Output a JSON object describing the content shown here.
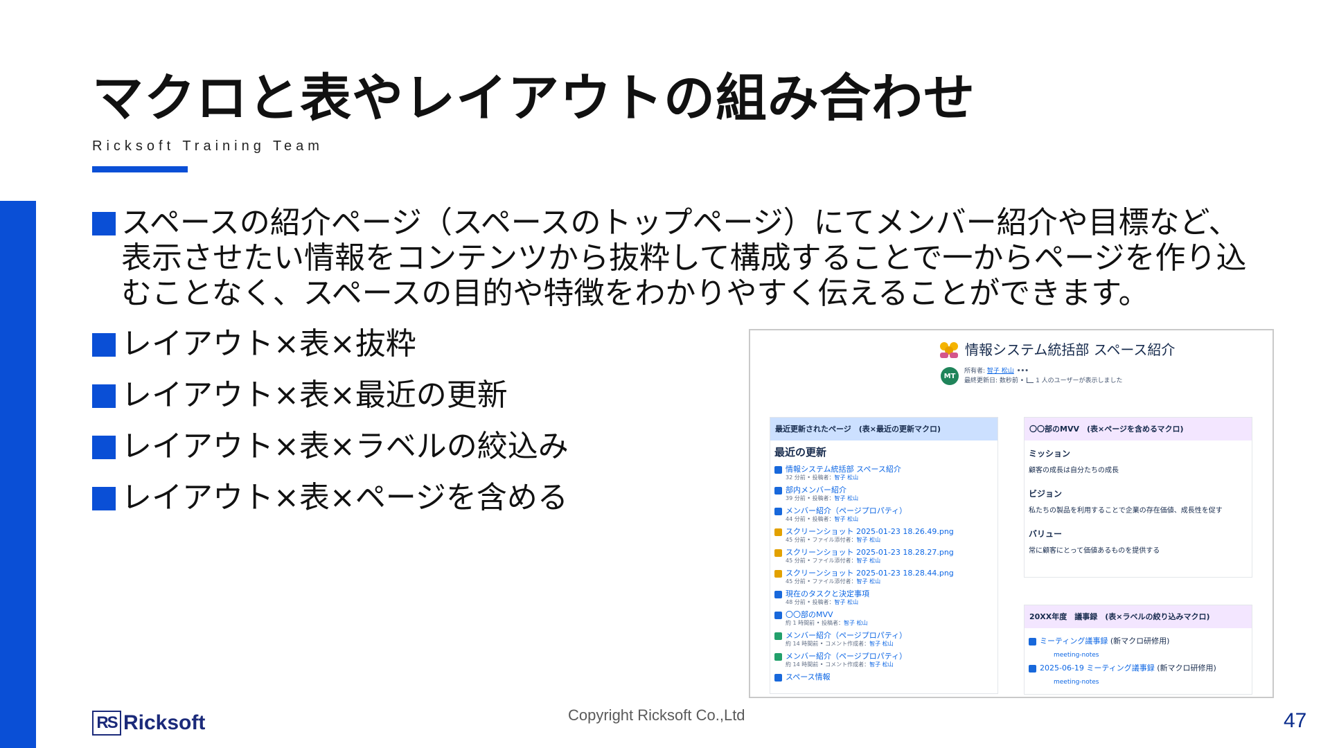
{
  "slide": {
    "title": "マクロと表やレイアウトの組み合わせ",
    "subtitle": "Ricksoft Training Team",
    "bullets": [
      "スペースの紹介ページ（スペースのトップページ）にてメンバー紹介や目標など、表示させたい情報をコンテンツから抜粋して構成することで一からページを作り込むことなく、スペースの目的や特徴をわかりやすく伝えることができます。",
      "レイアウト×表×抜粋",
      "レイアウト×表×最近の更新",
      "レイアウト×表×ラベルの絞込み",
      "レイアウト×表×ページを含める"
    ]
  },
  "screenshot": {
    "page_title": "情報システム統括部 スペース紹介",
    "owner_label": "所有者:",
    "owner_name": "智子 松山",
    "more_dots": "•••",
    "avatar_initials": "MT",
    "last_updated_label": "最終更新日: 数秒前 •",
    "viewers": "1 人のユーザーが表示しました",
    "left_column": {
      "header": "最近更新されたページ　(表×最近の更新マクロ)",
      "heading": "最近の更新",
      "items": [
        {
          "title": "情報システム統括部 スペース紹介",
          "meta": "32 分前 • 投稿者：",
          "who": "智子 松山",
          "icon": "page-icon"
        },
        {
          "title": "部内メンバー紹介",
          "meta": "39 分前 • 投稿者：",
          "who": "智子 松山",
          "icon": "page-icon"
        },
        {
          "title": "メンバー紹介（ページプロパティ）",
          "meta": "44 分前 • 投稿者：",
          "who": "智子 松山",
          "icon": "page-icon"
        },
        {
          "title": "スクリーンショット 2025-01-23 18.26.49.png",
          "meta": "45 分前 • ファイル添付者：",
          "who": "智子 松山",
          "icon": "image-icon"
        },
        {
          "title": "スクリーンショット 2025-01-23 18.28.27.png",
          "meta": "45 分前 • ファイル添付者：",
          "who": "智子 松山",
          "icon": "image-icon"
        },
        {
          "title": "スクリーンショット 2025-01-23 18.28.44.png",
          "meta": "45 分前 • ファイル添付者：",
          "who": "智子 松山",
          "icon": "image-icon"
        },
        {
          "title": "現在のタスクと決定事項",
          "meta": "48 分前 • 投稿者：",
          "who": "智子 松山",
          "icon": "page-icon"
        },
        {
          "title": "〇〇部のMVV",
          "meta": "約 1 時間前 • 投稿者：",
          "who": "智子 松山",
          "icon": "page-icon"
        },
        {
          "title": "メンバー紹介（ページプロパティ）",
          "meta": "約 14 時間前 • コメント作成者：",
          "who": "智子 松山",
          "icon": "comment-icon"
        },
        {
          "title": "メンバー紹介（ページプロパティ）",
          "meta": "約 14 時間前 • コメント作成者：",
          "who": "智子 松山",
          "icon": "comment-icon"
        },
        {
          "title": "スペース情報",
          "meta": "",
          "who": "",
          "icon": "page-icon"
        }
      ]
    },
    "right_top": {
      "header": "〇〇部のMVV　(表×ページを含めるマクロ)",
      "mission_h": "ミッション",
      "mission": "顧客の成長は自分たちの成長",
      "vision_h": "ビジョン",
      "vision": "私たちの製品を利用することで企業の存在価値、成長性を促す",
      "value_h": "バリュー",
      "value": "常に顧客にとって価値あるものを提供する"
    },
    "right_bottom": {
      "header": "20XX年度　議事録　(表×ラベルの絞り込みマクロ)",
      "items": [
        {
          "link": "ミーティング議事録",
          "suffix": " (新マクロ研修用)",
          "label": "meeting-notes"
        },
        {
          "link": "2025-06-19 ミーティング議事録",
          "suffix": " (新マクロ研修用)",
          "label": "meeting-notes"
        }
      ]
    }
  },
  "footer": {
    "logo_mark": "RS",
    "logo_text": "Ricksoft",
    "copyright": "Copyright Ricksoft Co.,Ltd",
    "page_number": "47"
  },
  "colors": {
    "accent": "#0a4fd6",
    "link": "#0c66e4",
    "logo": "#1b2a7a"
  }
}
